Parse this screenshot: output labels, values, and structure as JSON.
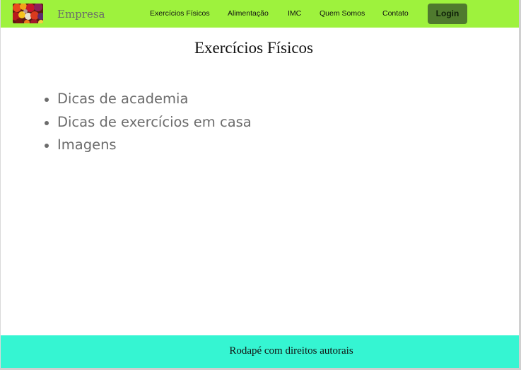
{
  "header": {
    "logo_icon": "fruit-basket-logo-image",
    "brand": "Empresa",
    "nav_items": [
      {
        "label": "Exercícios Físicos"
      },
      {
        "label": "Alimentação"
      },
      {
        "label": "IMC"
      },
      {
        "label": "Quem Somos"
      },
      {
        "label": "Contato"
      }
    ],
    "login_label": "Login"
  },
  "main": {
    "title": "Exercícios Físicos",
    "items": [
      {
        "label": "Dicas de academia"
      },
      {
        "label": "Dicas de exercícios em casa"
      },
      {
        "label": "Imagens"
      }
    ]
  },
  "footer": {
    "text": "Rodapé com direitos autorais"
  },
  "colors": {
    "navbar_bg": "#9ef23d",
    "login_bg": "#4f7a2e",
    "footer_bg": "#35f5d2",
    "list_text": "#6c6c6c"
  }
}
